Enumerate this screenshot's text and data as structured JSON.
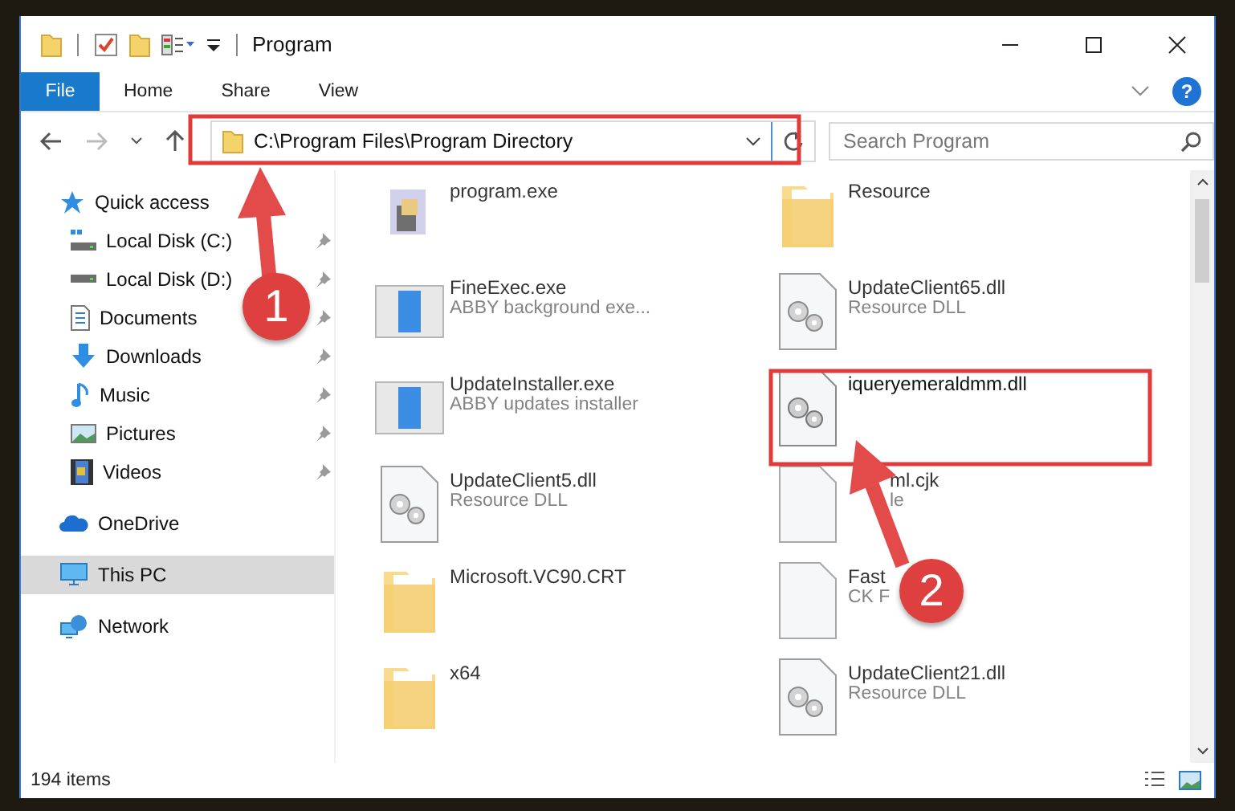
{
  "window": {
    "title": "Program"
  },
  "ribbon_tabs": [
    {
      "label": "File",
      "kind": "file"
    },
    {
      "label": "Home",
      "kind": "tab"
    },
    {
      "label": "Share",
      "kind": "tab"
    },
    {
      "label": "View",
      "kind": "tab"
    }
  ],
  "help": "?",
  "address": {
    "path": "C:\\Program Files\\Program Directory",
    "annotated": true
  },
  "search": {
    "placeholder": "Search Program"
  },
  "nav": [
    {
      "label": "Quick access",
      "kind": "star",
      "selected": false,
      "children": [
        {
          "label": "Local Disk (C:)",
          "kind": "windisk",
          "selected": false,
          "pinned": true
        },
        {
          "label": "Local Disk (D:)",
          "kind": "disk",
          "selected": false,
          "pinned": true
        },
        {
          "label": "Documents",
          "kind": "doc",
          "selected": false,
          "pinned": true
        },
        {
          "label": "Downloads",
          "kind": "download",
          "selected": false,
          "pinned": true
        },
        {
          "label": "Music",
          "kind": "music",
          "selected": false,
          "pinned": true
        },
        {
          "label": "Pictures",
          "kind": "pictures",
          "selected": false,
          "pinned": true
        },
        {
          "label": "Videos",
          "kind": "video",
          "selected": false,
          "pinned": true
        }
      ]
    },
    {
      "label": "OneDrive",
      "kind": "cloud",
      "selected": false
    },
    {
      "label": "This PC",
      "kind": "pc",
      "selected": true
    },
    {
      "label": "Network",
      "kind": "network",
      "selected": false
    }
  ],
  "files": [
    {
      "name": "program.exe",
      "kind": "setup",
      "blurred": true
    },
    {
      "name": "Resource",
      "kind": "folder",
      "blurred": true
    },
    {
      "name": "FineExec.exe",
      "detail": "ABBY background exe...",
      "kind": "app",
      "blurred": true
    },
    {
      "name": "UpdateClient65.dll",
      "detail": "Resource DLL",
      "kind": "dll",
      "blurred": true
    },
    {
      "name": "UpdateInstaller.exe",
      "detail": "ABBY updates installer",
      "kind": "app",
      "blurred": true
    },
    {
      "name": "iqueryemeraldmm.dll",
      "kind": "dll",
      "blurred": false,
      "annotated": true
    },
    {
      "name": "UpdateClient5.dll",
      "detail": "Resource DLL",
      "kind": "dll",
      "blurred": true
    },
    {
      "name_tail": "ml.cjk",
      "detail_tail": "le",
      "kind": "blank",
      "blurred": true
    },
    {
      "name": "Microsoft.VC90.CRT",
      "kind": "folder",
      "blurred": true
    },
    {
      "name": "Fast",
      "detail": "CK F",
      "kind": "blank",
      "blurred": true
    },
    {
      "name": "x64",
      "kind": "folder",
      "blurred": true
    },
    {
      "name": "UpdateClient21.dll",
      "detail": "Resource DLL",
      "kind": "dll",
      "blurred": true
    }
  ],
  "callouts": [
    {
      "number": "1"
    },
    {
      "number": "2"
    }
  ],
  "status_bar": {
    "count": "194 items"
  }
}
